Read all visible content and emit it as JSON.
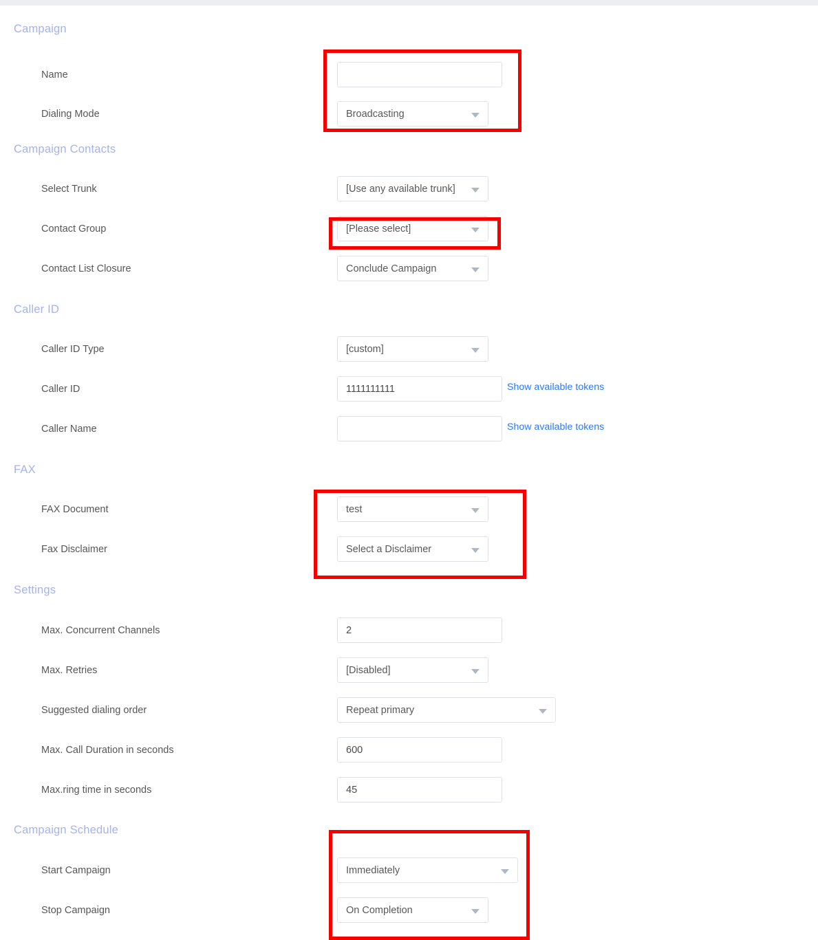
{
  "theme": {
    "section_heading_color": "#a5b2f0",
    "label_color": "#575757",
    "link_color": "#2979ff",
    "field_border_color": "#dfe3e6",
    "annotation_color": "#f70000",
    "top_strip_color": "#eceff1"
  },
  "sections": [
    {
      "id": "campaign",
      "title": "Campaign",
      "fields": [
        {
          "label": "Name",
          "type": "text",
          "value": "",
          "placeholder": ""
        },
        {
          "label": "Dialing Mode",
          "type": "select",
          "value": "Broadcasting"
        }
      ]
    },
    {
      "id": "campaign_contacts",
      "title": "Campaign Contacts",
      "fields": [
        {
          "label": "Select Trunk",
          "type": "select",
          "value": "[Use any available trunk]"
        },
        {
          "label": "Contact Group",
          "type": "select",
          "value": "[Please select]"
        },
        {
          "label": "Contact List Closure",
          "type": "select",
          "value": "Conclude Campaign"
        }
      ]
    },
    {
      "id": "caller_id",
      "title": "Caller ID",
      "fields": [
        {
          "label": "Caller ID Type",
          "type": "select",
          "value": "[custom]"
        },
        {
          "label": "Caller ID",
          "type": "text",
          "value": "1111111111",
          "link": "Show available tokens"
        },
        {
          "label": "Caller Name",
          "type": "text",
          "value": "",
          "link": "Show available tokens"
        }
      ]
    },
    {
      "id": "fax",
      "title": "FAX",
      "fields": [
        {
          "label": "FAX Document",
          "type": "select",
          "value": "test"
        },
        {
          "label": "Fax Disclaimer",
          "type": "select",
          "value": "Select a Disclaimer"
        }
      ]
    },
    {
      "id": "settings",
      "title": "Settings",
      "fields": [
        {
          "label": "Max. Concurrent Channels",
          "type": "text",
          "value": "2"
        },
        {
          "label": "Max. Retries",
          "type": "select",
          "value": "[Disabled]"
        },
        {
          "label": "Suggested dialing order",
          "type": "select",
          "value": "Repeat primary"
        },
        {
          "label": "Max. Call Duration in seconds",
          "type": "text",
          "value": "600"
        },
        {
          "label": "Max.ring time in seconds",
          "type": "text",
          "value": "45"
        }
      ]
    },
    {
      "id": "campaign_schedule",
      "title": "Campaign Schedule",
      "fields": [
        {
          "label": "Start Campaign",
          "type": "select",
          "value": "Immediately"
        },
        {
          "label": "Stop Campaign",
          "type": "select",
          "value": "On Completion"
        }
      ]
    }
  ],
  "annotations": [
    {
      "name": "campaign-fields-highlight",
      "targets": "Name + Dialing Mode"
    },
    {
      "name": "contact-group-highlight",
      "targets": "Contact Group"
    },
    {
      "name": "fax-fields-highlight",
      "targets": "FAX Document + Fax Disclaimer"
    },
    {
      "name": "campaign-schedule-highlight",
      "targets": "Start Campaign + Stop Campaign"
    }
  ]
}
